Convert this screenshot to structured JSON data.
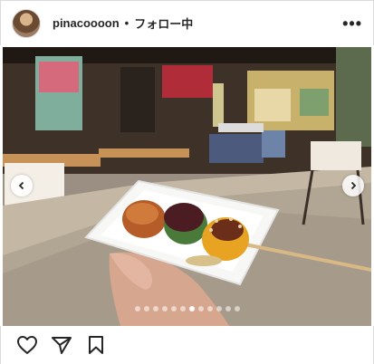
{
  "post": {
    "username": "pinacoooon",
    "separator": "•",
    "follow_status": "フォロー中",
    "more_label": "•••"
  },
  "media": {
    "carousel_total": 12,
    "carousel_active_index": 6
  },
  "colors": {
    "icon": "#262626",
    "border": "#dbdbdb"
  },
  "icons": {
    "like": "heart-icon",
    "share": "paper-plane-icon",
    "save": "bookmark-icon",
    "prev": "chevron-left-icon",
    "next": "chevron-right-icon"
  }
}
